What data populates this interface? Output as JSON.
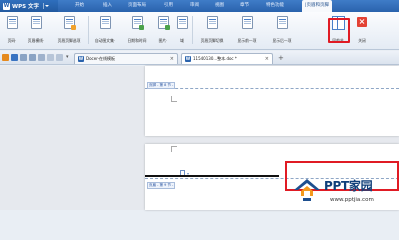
{
  "app": {
    "name": "WPS 文字",
    "logo_letter": "W"
  },
  "menu": [
    "开始",
    "插入",
    "页面布局",
    "引用",
    "审阅",
    "视图",
    "章节",
    "特色功能",
    "|页眉和页脚"
  ],
  "ribbon": {
    "buttons": [
      "页码·",
      "页眉横线·",
      "页眉页脚选项",
      "自动图文集·",
      "日期和时间",
      "图片·",
      "域",
      "页眉页脚切换",
      "显示前一项",
      "显示后一项",
      "同前节",
      "关闭"
    ]
  },
  "tabs": [
    {
      "label": "Docer-在线模板",
      "icon": "W"
    },
    {
      "label": "11540130...整本.doc *",
      "icon": "W"
    }
  ],
  "document": {
    "footer_tag": "页脚 - 第 8 节 -",
    "header_tag": "页眉 - 第 9 节 -"
  },
  "watermark": {
    "name": "PPT家园",
    "url": "www.pptjia.com"
  },
  "colors": {
    "accent": "#2a63ad",
    "highlight": "#e01b24"
  }
}
